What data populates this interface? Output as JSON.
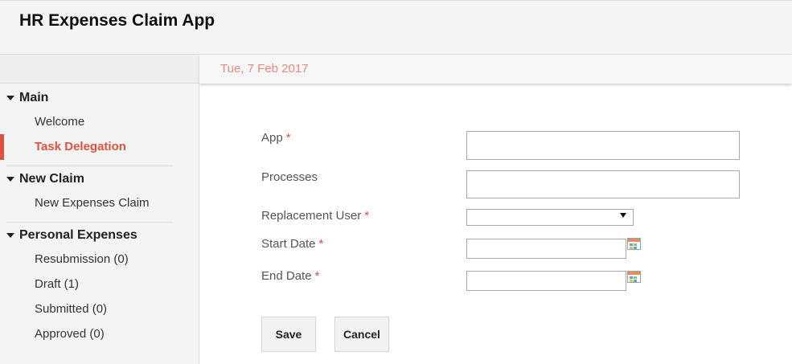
{
  "app": {
    "title": "HR Expenses Claim App"
  },
  "topbar": {
    "date": "Tue, 7 Feb 2017"
  },
  "sidebar": {
    "groups": [
      {
        "title": "Main",
        "items": [
          {
            "label": "Welcome"
          },
          {
            "label": "Task Delegation",
            "active": true
          }
        ]
      },
      {
        "title": "New Claim",
        "items": [
          {
            "label": "New Expenses Claim"
          }
        ]
      },
      {
        "title": "Personal Expenses",
        "items": [
          {
            "label": "Resubmission (0)"
          },
          {
            "label": "Draft (1)"
          },
          {
            "label": "Submitted (0)"
          },
          {
            "label": "Approved (0)"
          }
        ]
      }
    ]
  },
  "form": {
    "required_mark": "*",
    "app": {
      "label": "App",
      "value": ""
    },
    "processes": {
      "label": "Processes",
      "value": ""
    },
    "replacement_user": {
      "label": "Replacement User",
      "selected": ""
    },
    "start_date": {
      "label": "Start Date",
      "value": ""
    },
    "end_date": {
      "label": "End Date",
      "value": ""
    }
  },
  "buttons": {
    "save": "Save",
    "cancel": "Cancel"
  },
  "colors": {
    "accent": "#e0523f",
    "date_text": "#e48a80"
  }
}
